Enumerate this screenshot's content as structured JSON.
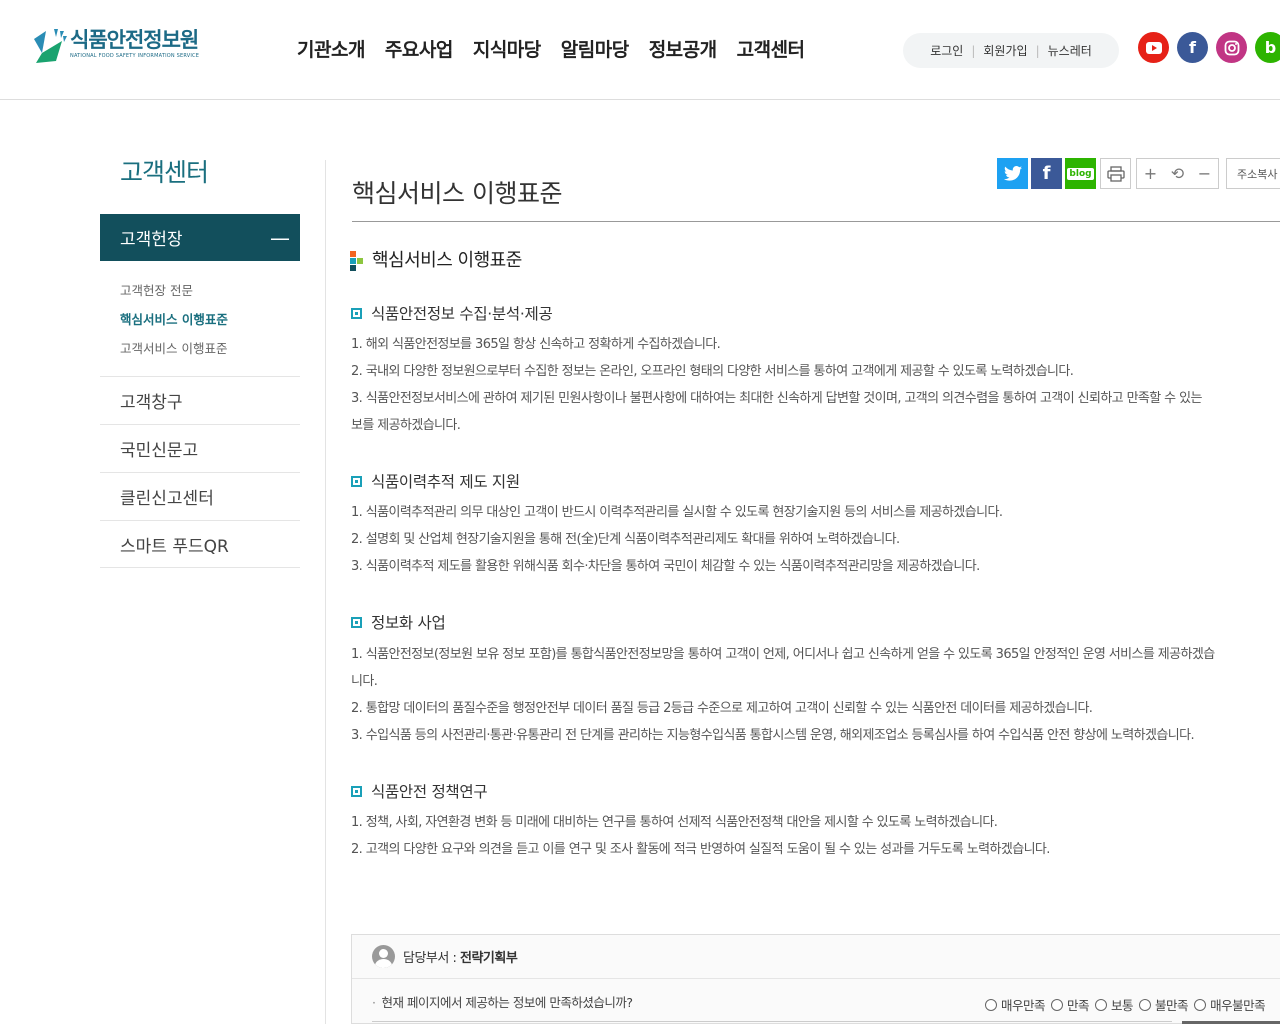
{
  "header": {
    "logo_ko": "식품안전정보원",
    "logo_en": "NATIONAL FOOD SAFETY INFORMATION SERVICE",
    "gnb": [
      "기관소개",
      "주요사업",
      "지식마당",
      "알림마당",
      "정보공개",
      "고객센터"
    ],
    "util": {
      "login": "로그인",
      "join": "회원가입",
      "newsletter": "뉴스레터"
    },
    "sns": {
      "youtube_color": "#e62117",
      "facebook_color": "#3b5998",
      "instagram_color": "#c13584",
      "blog_color": "#2db400"
    }
  },
  "sidebar": {
    "title": "고객센터",
    "active": "고객헌장",
    "sub_items": [
      "고객헌장 전문",
      "핵심서비스 이행표준",
      "고객서비스 이행표준"
    ],
    "items": [
      "고객창구",
      "국민신문고",
      "클린신고센터",
      "스마트 푸드QR"
    ]
  },
  "content": {
    "page_title": "핵심서비스 이행표준",
    "tools": {
      "blog": "blog",
      "address_copy": "주소복사"
    },
    "section_title": "핵심서비스 이행표준",
    "sections": [
      {
        "title": "식품안전정보 수집·분석·제공",
        "lines": [
          "1. 해외 식품안전정보를 365일 항상 신속하고 정확하게 수집하겠습니다.",
          "2. 국내외 다양한 정보원으로부터 수집한 정보는 온라인, 오프라인 형태의 다양한 서비스를 통하여 고객에게 제공할 수 있도록 노력하겠습니다.",
          "3. 식품안전정보서비스에 관하여 제기된 민원사항이나 불편사항에 대하여는 최대한 신속하게 답변할 것이며, 고객의 의견수렴을 통하여 고객이 신뢰하고 만족할 수 있는",
          "보를 제공하겠습니다."
        ]
      },
      {
        "title": "식품이력추적 제도 지원",
        "lines": [
          "1. 식품이력추적관리 의무 대상인 고객이 반드시 이력추적관리를 실시할 수 있도록 현장기술지원 등의 서비스를 제공하겠습니다.",
          "2. 설명회 및 산업체 현장기술지원을 통해 전(全)단계 식품이력추적관리제도 확대를 위하여 노력하겠습니다.",
          "3. 식품이력추적 제도를 활용한 위해식품 회수·차단을 통하여 국민이 체감할 수 있는 식품이력추적관리망을 제공하겠습니다."
        ]
      },
      {
        "title": "정보화 사업",
        "lines": [
          "1. 식품안전정보(정보원 보유 정보 포함)를 통합식품안전정보망을 통하여 고객이 언제, 어디서나 쉽고 신속하게 얻을 수 있도록 365일 안정적인 운영 서비스를 제공하겠습",
          "니다.",
          "2. 통합망 데이터의 품질수준을 행정안전부 데이터 품질 등급 2등급 수준으로 제고하여 고객이 신뢰할 수 있는 식품안전 데이터를 제공하겠습니다.",
          "3. 수입식품 등의 사전관리·통관·유통관리 전 단계를 관리하는 지능형수입식품 통합시스템 운영, 해외제조업소 등록심사를 하여 수입식품 안전 향상에 노력하겠습니다."
        ]
      },
      {
        "title": "식품안전 정책연구",
        "lines": [
          "1. 정책, 사회, 자연환경 변화 등 미래에 대비하는 연구를 통하여 선제적 식품안전정책 대안을 제시할 수 있도록 노력하겠습니다.",
          "2. 고객의 다양한 요구와 의견을 듣고 이를 연구 및 조사 활동에 적극 반영하여 실질적 도움이 될 수 있는 성과를 거두도록 노력하겠습니다."
        ]
      }
    ]
  },
  "survey": {
    "dept_label": "담당부서 :",
    "dept_value": "전략기획부",
    "question": "현재 페이지에서 제공하는 정보에 만족하셨습니까?",
    "options": [
      "매우만족",
      "만족",
      "보통",
      "불만족",
      "매우불만족"
    ]
  }
}
